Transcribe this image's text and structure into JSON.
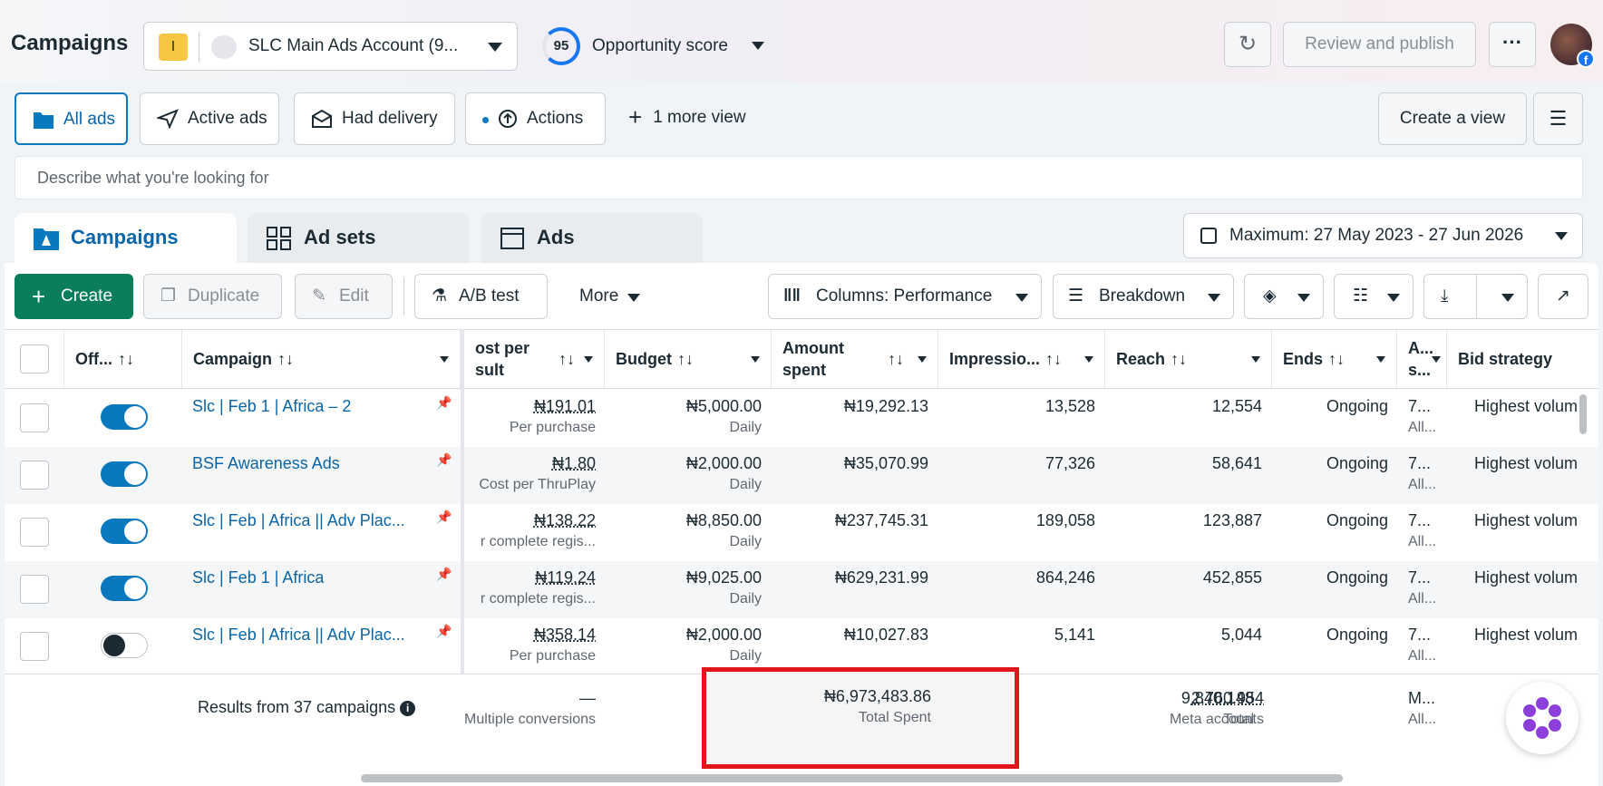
{
  "header": {
    "title": "Campaigns",
    "account_badge": "I",
    "account_name": "SLC Main Ads Account (9...",
    "opportunity_score": "95",
    "opportunity_label": "Opportunity score",
    "review_label": "Review and publish",
    "more_label": "···",
    "avatar_badge": "f"
  },
  "views": {
    "all_ads": "All ads",
    "active_ads": "Active ads",
    "had_delivery": "Had delivery",
    "actions": "Actions",
    "more_view": "1 more view",
    "create_view": "Create a view",
    "search_placeholder": "Describe what you're looking for"
  },
  "tabs": {
    "campaigns": "Campaigns",
    "ad_sets": "Ad sets",
    "ads": "Ads"
  },
  "date_range": "Maximum: 27 May 2023 - 27 Jun 2026",
  "toolbar": {
    "create": "Create",
    "duplicate": "Duplicate",
    "edit": "Edit",
    "ab_test": "A/B test",
    "more": "More",
    "columns": "Columns: Performance",
    "breakdown": "Breakdown"
  },
  "table": {
    "headers": {
      "off": "Off...",
      "campaign": "Campaign",
      "cost_per_result_1": "ost per",
      "cost_per_result_2": "sult",
      "budget": "Budget",
      "amount_spent_1": "Amount",
      "amount_spent_2": "spent",
      "impressions": "Impressio...",
      "reach": "Reach",
      "ends": "Ends",
      "attr_1": "A...",
      "attr_2": "s...",
      "bid_strategy": "Bid strategy"
    },
    "sort_glyph": "↑↓",
    "rows": [
      {
        "on": true,
        "name": "Slc | Feb 1 | Africa – 2",
        "cost": "₦191.01",
        "cost_sub": "Per purchase",
        "budget": "₦5,000.00",
        "budget_sub": "Daily",
        "spent": "₦19,292.13",
        "impressions": "13,528",
        "reach": "12,554",
        "ends": "Ongoing",
        "attr": "7...",
        "attr_sub": "All...",
        "bid": "Highest volum"
      },
      {
        "on": true,
        "name": "BSF Awareness Ads",
        "cost": "₦1.80",
        "cost_sub": "Cost per ThruPlay",
        "budget": "₦2,000.00",
        "budget_sub": "Daily",
        "spent": "₦35,070.99",
        "impressions": "77,326",
        "reach": "58,641",
        "ends": "Ongoing",
        "attr": "7...",
        "attr_sub": "All...",
        "bid": "Highest volum"
      },
      {
        "on": true,
        "name": "Slc | Feb | Africa || Adv Plac...",
        "cost": "₦138.22",
        "cost_sub": "r complete regis...",
        "budget": "₦8,850.00",
        "budget_sub": "Daily",
        "spent": "₦237,745.31",
        "impressions": "189,058",
        "reach": "123,887",
        "ends": "Ongoing",
        "attr": "7...",
        "attr_sub": "All...",
        "bid": "Highest volum"
      },
      {
        "on": true,
        "name": "Slc | Feb 1 | Africa",
        "cost": "₦119.24",
        "cost_sub": "r complete regis...",
        "budget": "₦9,025.00",
        "budget_sub": "Daily",
        "spent": "₦629,231.99",
        "impressions": "864,246",
        "reach": "452,855",
        "ends": "Ongoing",
        "attr": "7...",
        "attr_sub": "All...",
        "bid": "Highest volum"
      },
      {
        "on": false,
        "name": "Slc | Feb | Africa || Adv Plac...",
        "cost": "₦358.14",
        "cost_sub": "Per purchase",
        "budget": "₦2,000.00",
        "budget_sub": "Daily",
        "spent": "₦10,027.83",
        "impressions": "5,141",
        "reach": "5,044",
        "ends": "Ongoing",
        "attr": "7...",
        "attr_sub": "All...",
        "bid": "Highest volum"
      }
    ],
    "footer": {
      "results": "Results from 37 campaigns",
      "cost": "—",
      "cost_sub": "Multiple conversions",
      "spent": "₦6,973,483.86",
      "spent_sub": "Total Spent",
      "impressions": "9,840,148",
      "impressions_sub": "Total",
      "reach": "2,760,954",
      "reach_sub": "Meta accounts",
      "attr": "M...",
      "attr_sub": "All..."
    }
  },
  "colors": {
    "primary_blue": "#0a78be",
    "create_green": "#0a7e5a",
    "highlight_red": "#e0161b"
  }
}
